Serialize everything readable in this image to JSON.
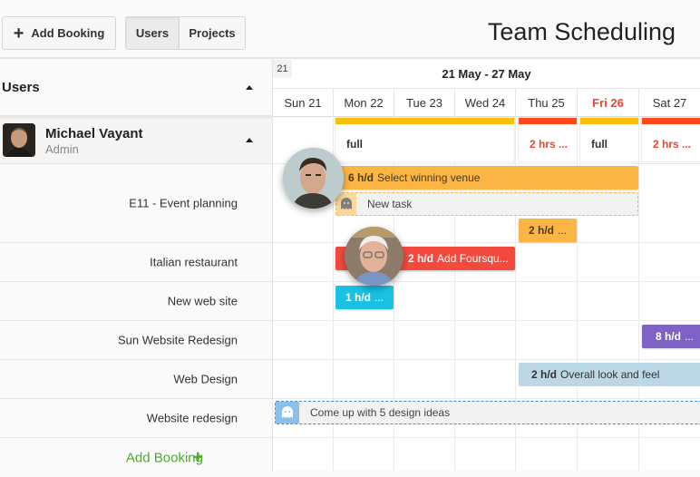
{
  "toolbar": {
    "add_booking_label": "Add Booking",
    "view_toggle": [
      {
        "label": "Users",
        "active": true
      },
      {
        "label": "Projects",
        "active": false
      }
    ],
    "title": "Team Scheduling"
  },
  "left_panel": {
    "header": "Users",
    "user": {
      "name": "Michael Vayant",
      "role": "Admin"
    },
    "projects": [
      "E11 - Event planning",
      "Italian restaurant",
      "New web site",
      "Sun Website Redesign",
      "Web Design",
      "Website redesign"
    ],
    "add_booking_label": "Add Booking"
  },
  "calendar": {
    "week_number": "21",
    "week_range": "21 May - 27 May",
    "days": [
      {
        "label": "Sun 21",
        "highlight": false
      },
      {
        "label": "Mon 22",
        "highlight": false
      },
      {
        "label": "Tue 23",
        "highlight": false
      },
      {
        "label": "Wed 24",
        "highlight": false
      },
      {
        "label": "Thu 25",
        "highlight": false
      },
      {
        "label": "Fri 26",
        "highlight": true
      },
      {
        "label": "Sat 27",
        "highlight": false
      }
    ],
    "availability": [
      {
        "text": "full",
        "status": "full"
      },
      {
        "text": "2 hrs ...",
        "status": "over"
      },
      {
        "text": "full",
        "status": "full"
      },
      {
        "text": "2 hrs ...",
        "status": "over"
      }
    ],
    "bookings": [
      {
        "hours": "6 h/d",
        "title": "Select winning venue",
        "project": "E11 - Event planning",
        "color": "#fbb545"
      },
      {
        "hours": "2 h/d",
        "title": "...",
        "project": "E11 - Event planning",
        "color": "#fbb545"
      },
      {
        "hours": "2 h/d",
        "title": "Add Foursqu...",
        "project": "Italian restaurant",
        "color": "#f44a3d"
      },
      {
        "hours": "1 h/d",
        "title": "...",
        "project": "New web site",
        "color": "#19c1e3"
      },
      {
        "hours": "8 h/d",
        "title": "...",
        "project": "Sun Website Redesign",
        "color": "#7e62c6"
      },
      {
        "hours": "2 h/d",
        "title": "Overall look and feel",
        "project": "Web Design",
        "color": "#bcd8e7"
      }
    ],
    "placeholders": [
      {
        "title": "New task",
        "project": "E11 - Event planning",
        "color": "#fbb545"
      },
      {
        "title": "Come up with 5 design ideas",
        "project": "Website redesign",
        "color": "#3b93d6"
      }
    ]
  },
  "colors": {
    "full": "#f9c00a",
    "over": "#ff4a1c",
    "over_text": "#f0442d",
    "add_green": "#4caa2c"
  }
}
